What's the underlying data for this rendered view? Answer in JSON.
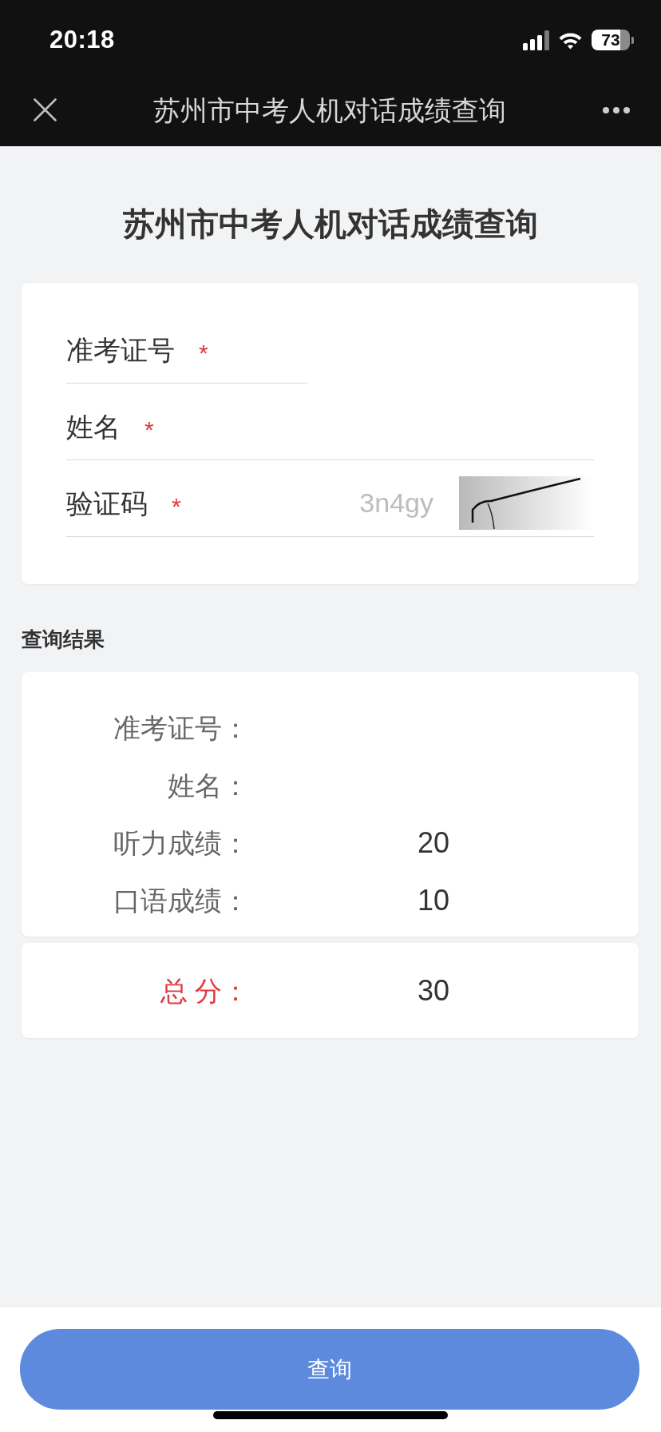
{
  "status_bar": {
    "time": "20:18",
    "battery": "73"
  },
  "nav_bar": {
    "title": "苏州市中考人机对话成绩查询"
  },
  "page_title": "苏州市中考人机对话成绩查询",
  "form": {
    "fields": [
      {
        "kind": "text",
        "label": "准考证号",
        "required_mark": "*"
      },
      {
        "kind": "text",
        "label": "姓名",
        "required_mark": "*"
      },
      {
        "kind": "captcha",
        "label": "验证码",
        "required_mark": "*",
        "placeholder": "3n4gy"
      }
    ]
  },
  "results": {
    "heading": "查询结果",
    "rows": [
      {
        "label": "准考证号："
      },
      {
        "label": "姓名："
      },
      {
        "label": "听力成绩：",
        "value": "20"
      },
      {
        "label": "口语成绩：",
        "value": "10"
      }
    ]
  },
  "total": {
    "label": "总 分：",
    "value": "30"
  },
  "submit_button": {
    "label": "查询"
  }
}
